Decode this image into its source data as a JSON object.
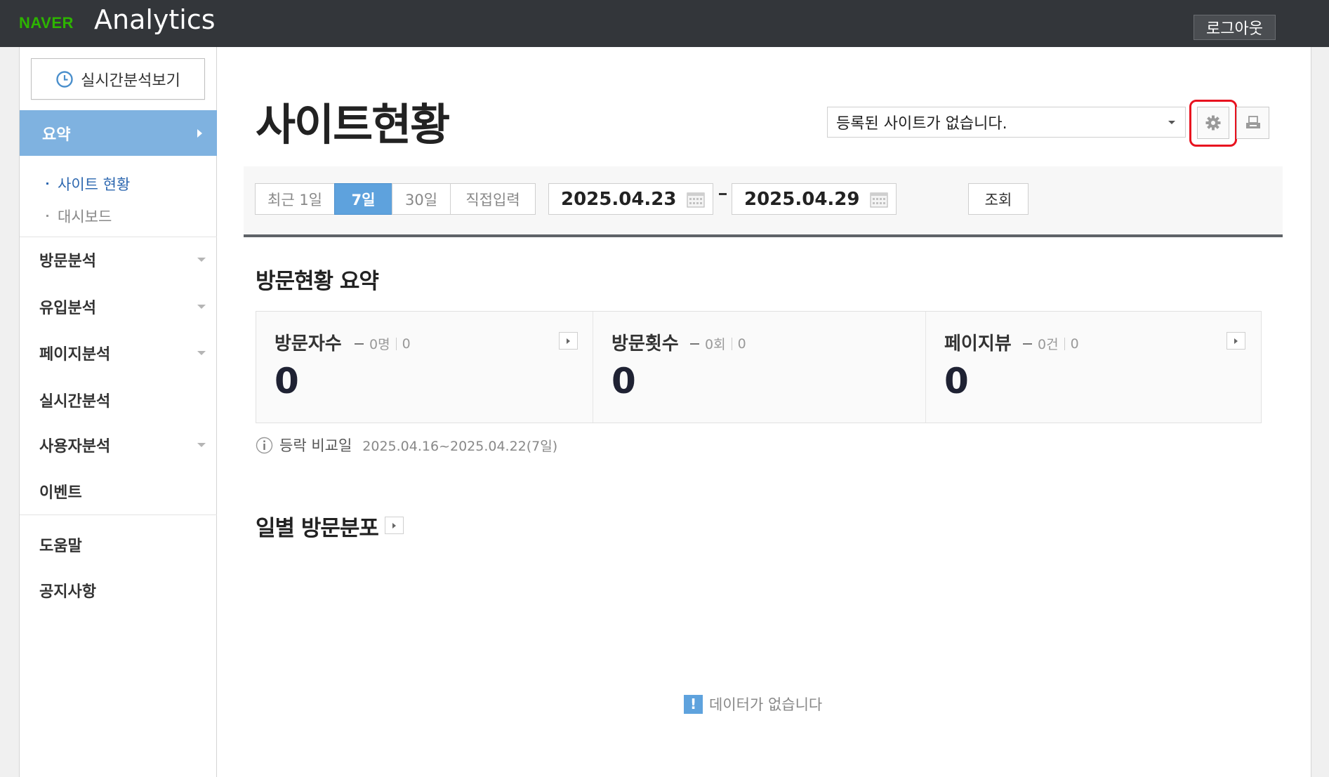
{
  "header": {
    "logo_brand": "NAVER",
    "logo_product": "Analytics",
    "logout_label": "로그아웃"
  },
  "sidebar": {
    "realtime_button": "실시간분석보기",
    "active_section": "요약",
    "sub_items": [
      {
        "label": "사이트 현황",
        "active": true
      },
      {
        "label": "대시보드",
        "active": false
      }
    ],
    "nav_items": [
      {
        "label": "방문분석",
        "expandable": true
      },
      {
        "label": "유입분석",
        "expandable": true
      },
      {
        "label": "페이지분석",
        "expandable": true
      },
      {
        "label": "실시간분석",
        "expandable": false
      },
      {
        "label": "사용자분석",
        "expandable": true
      },
      {
        "label": "이벤트",
        "expandable": false
      }
    ],
    "footer_items": [
      {
        "label": "도움말"
      },
      {
        "label": "공지사항"
      }
    ]
  },
  "main": {
    "page_title": "사이트현황",
    "site_select_value": "등록된 사이트가 없습니다.",
    "settings_icon": "gear-icon",
    "print_icon": "printer-icon",
    "highlight_color": "#e8121f",
    "range_buttons": [
      {
        "label": "최근 1일",
        "active": false
      },
      {
        "label": "7일",
        "active": true
      },
      {
        "label": "30일",
        "active": false
      },
      {
        "label": "직접입력",
        "active": false
      }
    ],
    "start_date": "2025.04.23",
    "end_date": "2025.04.29",
    "search_label": "조회",
    "summary_title": "방문현황 요약",
    "stats": [
      {
        "name": "방문자수",
        "compare_value": "0명",
        "change": "0",
        "value": "0"
      },
      {
        "name": "방문횟수",
        "compare_value": "0회",
        "change": "0",
        "value": "0"
      },
      {
        "name": "페이지뷰",
        "compare_value": "0건",
        "change": "0",
        "value": "0"
      }
    ],
    "compare_label": "등락 비교일",
    "compare_range": "2025.04.16~2025.04.22(7일)",
    "daily_title": "일별 방문분포",
    "no_data_text": "데이터가 없습니다",
    "accent_color": "#5ea2dd"
  }
}
